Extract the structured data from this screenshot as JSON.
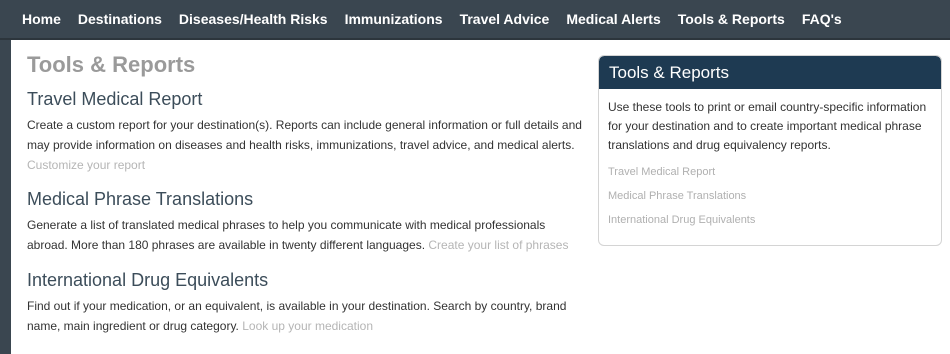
{
  "nav": {
    "items": [
      "Home",
      "Destinations",
      "Diseases/Health Risks",
      "Immunizations",
      "Travel Advice",
      "Medical Alerts",
      "Tools & Reports",
      "FAQ's"
    ]
  },
  "main": {
    "title": "Tools & Reports",
    "sections": [
      {
        "heading": "Travel Medical Report",
        "body": "Create a custom report for your destination(s). Reports can include general information or full details and may provide information on diseases and health risks, immunizations, travel advice, and medical alerts.",
        "link": "Customize your report"
      },
      {
        "heading": "Medical Phrase Translations",
        "body": "Generate a list of translated medical phrases to help you communicate with medical professionals abroad. More than 180 phrases are available in twenty different languages.",
        "link": "Create your list of phrases"
      },
      {
        "heading": "International Drug Equivalents",
        "body": "Find out if your medication, or an equivalent, is available in your destination. Search by country, brand name, main ingredient or drug category.",
        "link": "Look up your medication"
      }
    ]
  },
  "sidebar": {
    "title": "Tools & Reports",
    "description": "Use these tools to print or email country-specific information for your destination and to create important medical phrase translations and drug equivalency reports.",
    "links": [
      "Travel Medical Report",
      "Medical Phrase Translations",
      "International Drug Equivalents"
    ]
  },
  "colors": {
    "nav_background": "#3a4650",
    "box_header": "#1e3a52",
    "link_text": "#b5b5b5",
    "heading_text": "#3c4d5a"
  }
}
